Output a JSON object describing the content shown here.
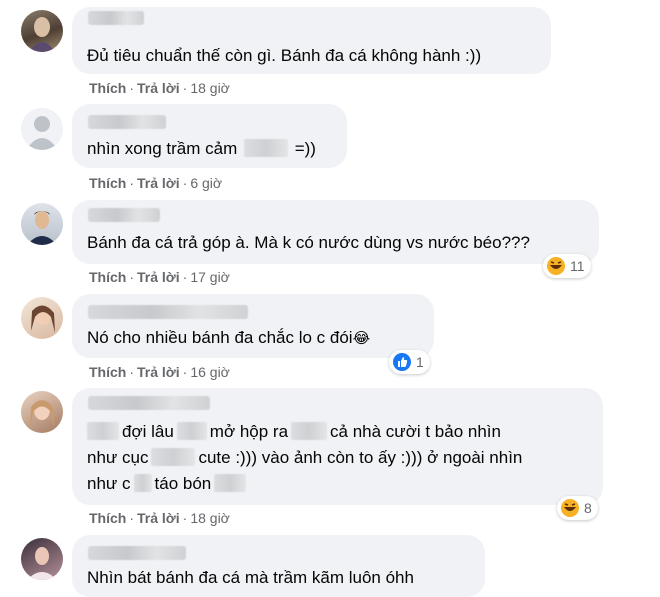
{
  "comments": [
    {
      "text": "Đủ tiêu chuẩn thế còn gì. Bánh đa cá không hành :))",
      "like": "Thích",
      "reply": "Trả lời",
      "time": "18 giờ"
    },
    {
      "text_a": "nhìn xong trầm cảm",
      "text_b": "=))",
      "like": "Thích",
      "reply": "Trả lời",
      "time": "6 giờ"
    },
    {
      "text": "Bánh đa cá trả góp à. Mà k có nước dùng vs nước béo???",
      "like": "Thích",
      "reply": "Trả lời",
      "time": "17 giờ",
      "reaction": {
        "icon": "haha-emoji-icon",
        "count": "11"
      }
    },
    {
      "text": "Nó cho nhiều bánh đa chắc lo c đói",
      "emoji": "😂",
      "like": "Thích",
      "reply": "Trả lời",
      "time": "16 giờ",
      "reaction": {
        "icon": "like-thumb-icon",
        "count": "1"
      }
    },
    {
      "line1_a": "đợi lâu",
      "line1_b": "mở hộp ra",
      "line1_c": "cả nhà cười t bảo nhìn",
      "line2_a": "như cục",
      "line2_b": "cute :))) vào ảnh còn to ấy :))) ở ngoài nhìn",
      "line3_a": "như c",
      "line3_b": "táo bón",
      "like": "Thích",
      "reply": "Trả lời",
      "time": "18 giờ",
      "reaction": {
        "icon": "haha-emoji-icon",
        "count": "8"
      }
    },
    {
      "text": "Nhìn bát bánh đa cá mà trầm kãm luôn óhh"
    }
  ],
  "colors": {
    "bubble": "#f0f2f5",
    "meta": "#65676b",
    "like_blue": "#1877f2",
    "haha_yellow": "#f7b125"
  }
}
